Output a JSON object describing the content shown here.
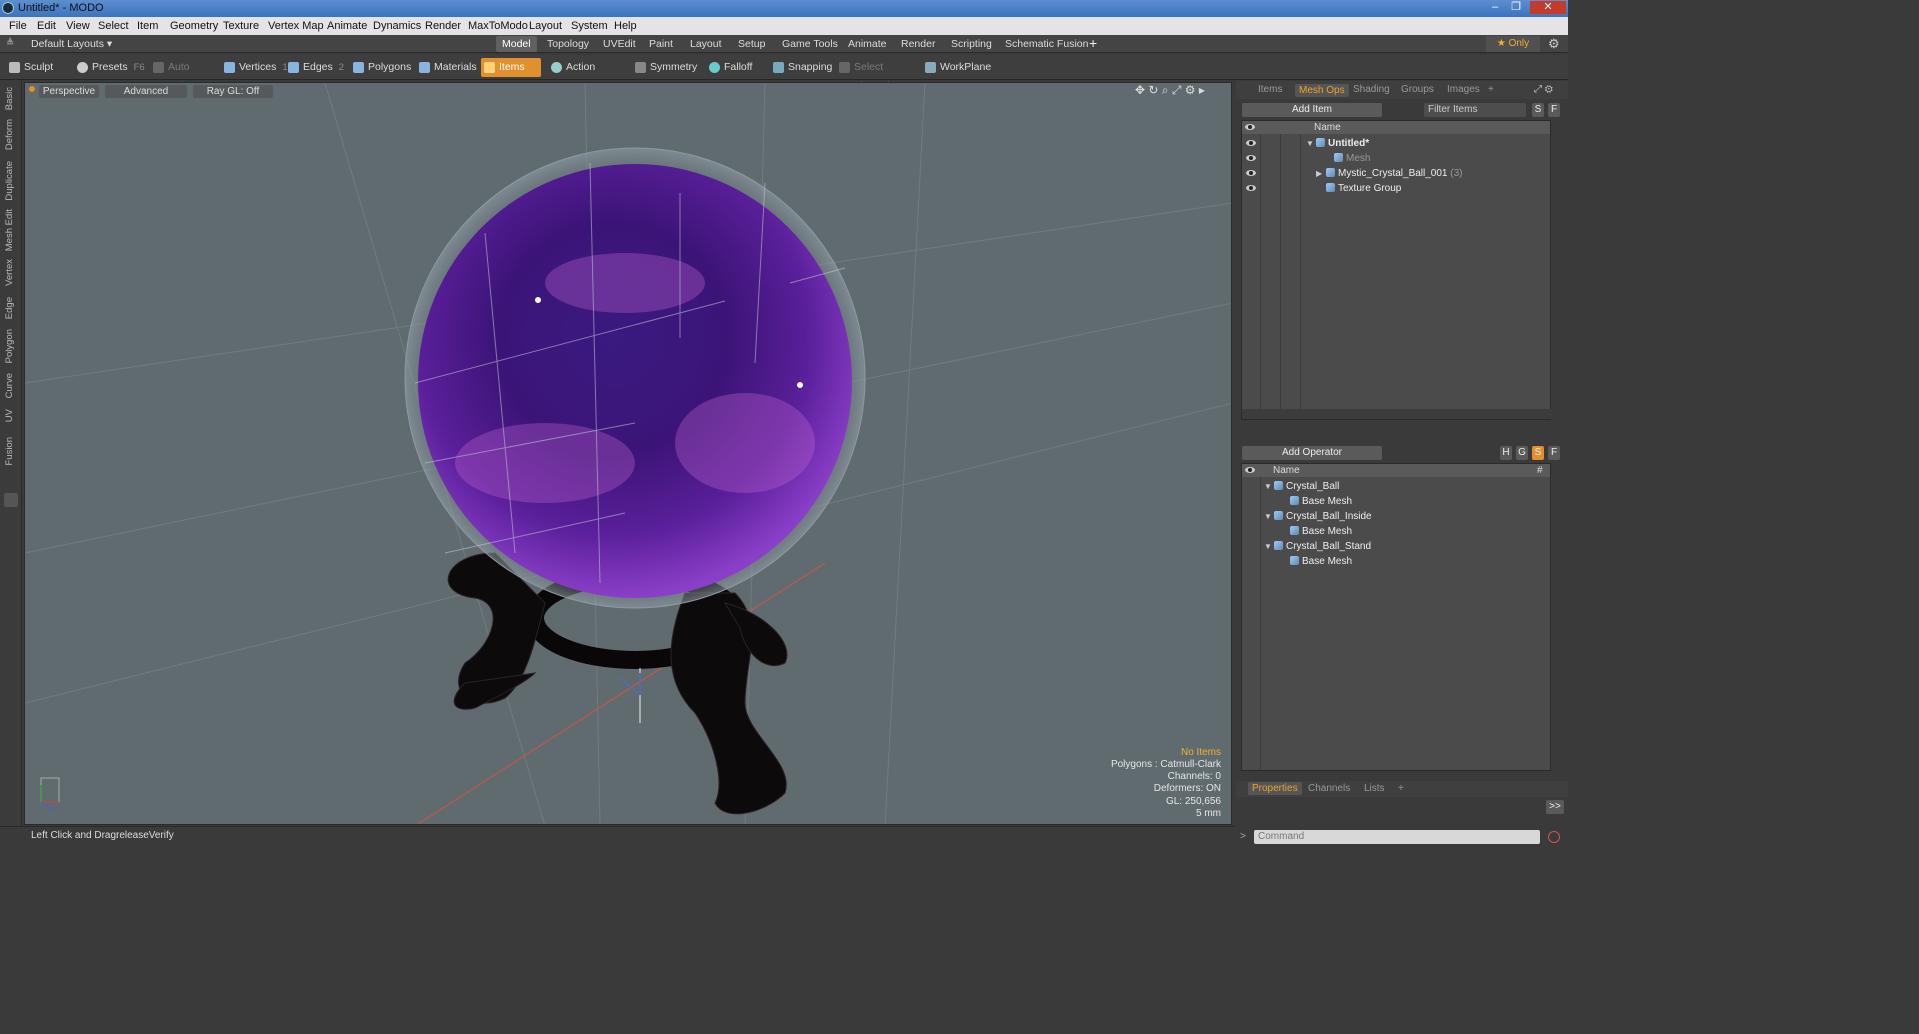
{
  "window": {
    "title": "Untitled* - MODO",
    "controls": [
      "–",
      "❐",
      "✕"
    ]
  },
  "menu": [
    "File",
    "Edit",
    "View",
    "Select",
    "Item",
    "Geometry",
    "Texture",
    "Vertex Map",
    "Animate",
    "Dynamics",
    "Render",
    "MaxToModo",
    "Layout",
    "System",
    "Help"
  ],
  "modebar": {
    "layout_label": "Default Layouts ▾",
    "modes": [
      "Model",
      "Topology",
      "UVEdit",
      "Paint",
      "Layout",
      "Setup",
      "Game Tools",
      "Animate",
      "Render",
      "Scripting",
      "Schematic Fusion"
    ],
    "active_mode": "Model",
    "only_label": "★ Only"
  },
  "toolbar": {
    "sculpt": "Sculpt",
    "presets": "Presets",
    "presets_key": "F6",
    "auto_select": "Auto Select",
    "vertices": "Vertices",
    "vertices_key": "1",
    "edges": "Edges",
    "edges_key": "2",
    "polygons": "Polygons",
    "materials": "Materials",
    "items": "Items",
    "action_center": "Action Center",
    "symmetry": "Symmetry",
    "falloff": "Falloff",
    "snapping": "Snapping",
    "select_through": "Select Through",
    "workplane": "WorkPlane"
  },
  "left_tabs": [
    "Basic",
    "Deform",
    "Duplicate",
    "Mesh Edit",
    "Vertex",
    "Edge",
    "Polygon",
    "Curve",
    "UV",
    "Fusion"
  ],
  "viewport": {
    "view": "Perspective",
    "shading": "Advanced",
    "raygl": "Ray GL: Off",
    "stats": {
      "items": "No Items",
      "polygons": "Polygons : Catmull-Clark",
      "channels": "Channels: 0",
      "deformers": "Deformers: ON",
      "gl": "GL: 250,656",
      "unit": "5 mm"
    }
  },
  "status": {
    "label": "Left Click and Drag:",
    "value": "releaseVerify"
  },
  "items_panel": {
    "tabs": [
      "Items",
      "Mesh Ops",
      "Shading",
      "Groups",
      "Images"
    ],
    "active_tab": "Mesh Ops",
    "add_item": "Add Item",
    "filter_placeholder": "Filter Items",
    "col_name": "Name",
    "s_btn": "S",
    "f_btn": "F",
    "tree": [
      {
        "label": "Untitled*",
        "bold": true
      },
      {
        "label": "Mesh",
        "dim": true
      },
      {
        "label": "Mystic_Crystal_Ball_001",
        "count": "(3)"
      },
      {
        "label": "Texture Group"
      }
    ]
  },
  "meshops_panel": {
    "add_operator": "Add Operator",
    "col_name": "Name",
    "col_hash": "#",
    "buttons": [
      "H",
      "G",
      "S",
      "F"
    ],
    "tree": [
      {
        "label": "Crystal_Ball",
        "level": 0
      },
      {
        "label": "Base Mesh",
        "level": 1
      },
      {
        "label": "Crystal_Ball_Inside",
        "level": 0
      },
      {
        "label": "Base Mesh",
        "level": 1
      },
      {
        "label": "Crystal_Ball_Stand",
        "level": 0
      },
      {
        "label": "Base Mesh",
        "level": 1
      }
    ]
  },
  "props_panel": {
    "tabs": [
      "Properties",
      "Channels",
      "Lists"
    ],
    "active_tab": "Properties",
    "command_placeholder": "Command",
    "expand": ">>"
  },
  "colors": {
    "accent": "#e0902c",
    "viewport_bg": "#606b70",
    "panel_bg": "#3a3a3a"
  }
}
